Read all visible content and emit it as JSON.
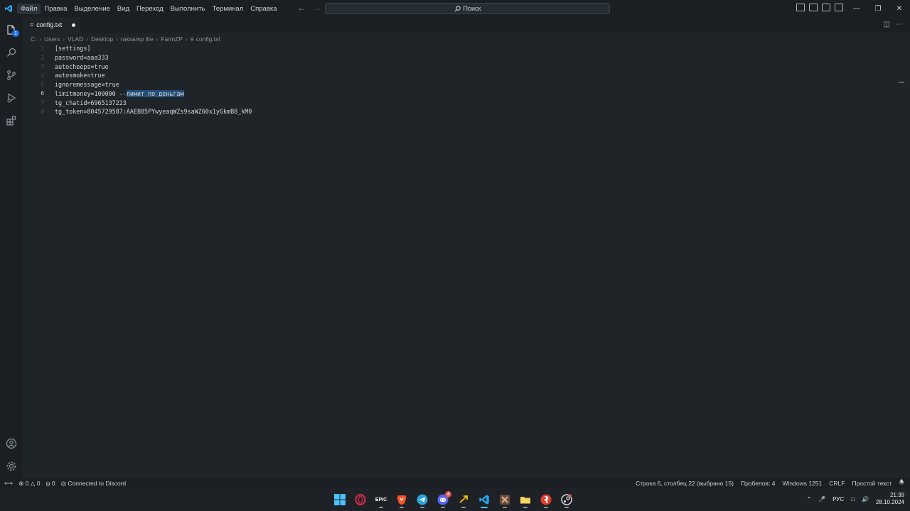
{
  "menu": [
    "Файл",
    "Правка",
    "Выделение",
    "Вид",
    "Переход",
    "Выполнить",
    "Терминал",
    "Справка"
  ],
  "search": {
    "placeholder": "Поиск"
  },
  "tab": {
    "title": "config.txt"
  },
  "breadcrumb": [
    "C:",
    "Users",
    "VLAD",
    "Desktop",
    "raksamp lite",
    "FarmZP",
    "config.txt"
  ],
  "editor": {
    "lines": [
      {
        "num": "1",
        "text": "[settings]"
      },
      {
        "num": "2",
        "text": "password=aaa333"
      },
      {
        "num": "3",
        "text": "autocheeps=true"
      },
      {
        "num": "4",
        "text": "autosmoke=true"
      },
      {
        "num": "5",
        "text": "ignoremessage=true"
      },
      {
        "num": "6",
        "text_before": "limitmoney=100000 --",
        "text_selected": "лимит по деньгам"
      },
      {
        "num": "7",
        "text": "tg_chatid=6965137223"
      },
      {
        "num": "8",
        "text": "tg_token=8045729587:AAEB85PYwyeaqWZs9saWZ60x1yGkmB8_kM0"
      }
    ],
    "current_line": "6"
  },
  "statusbar": {
    "errors": "0",
    "warnings": "0",
    "ports": "0",
    "discord": "Connected to Discord",
    "position": "Строка 6, столбец 22 (выбрано 15)",
    "spaces": "Пробелов: 4",
    "encoding": "Windows 1251",
    "eol": "CRLF",
    "language": "Простой текст"
  },
  "activitybar": {
    "explorer_badge": "1"
  },
  "taskbar": {
    "discord_badge": "4",
    "lang": "РУС",
    "time": "21:39",
    "date": "28.10.2024"
  },
  "colors": {
    "accent": "#1f6feb",
    "selection": "#264f78",
    "vscode_blue": "#23a9f2"
  }
}
